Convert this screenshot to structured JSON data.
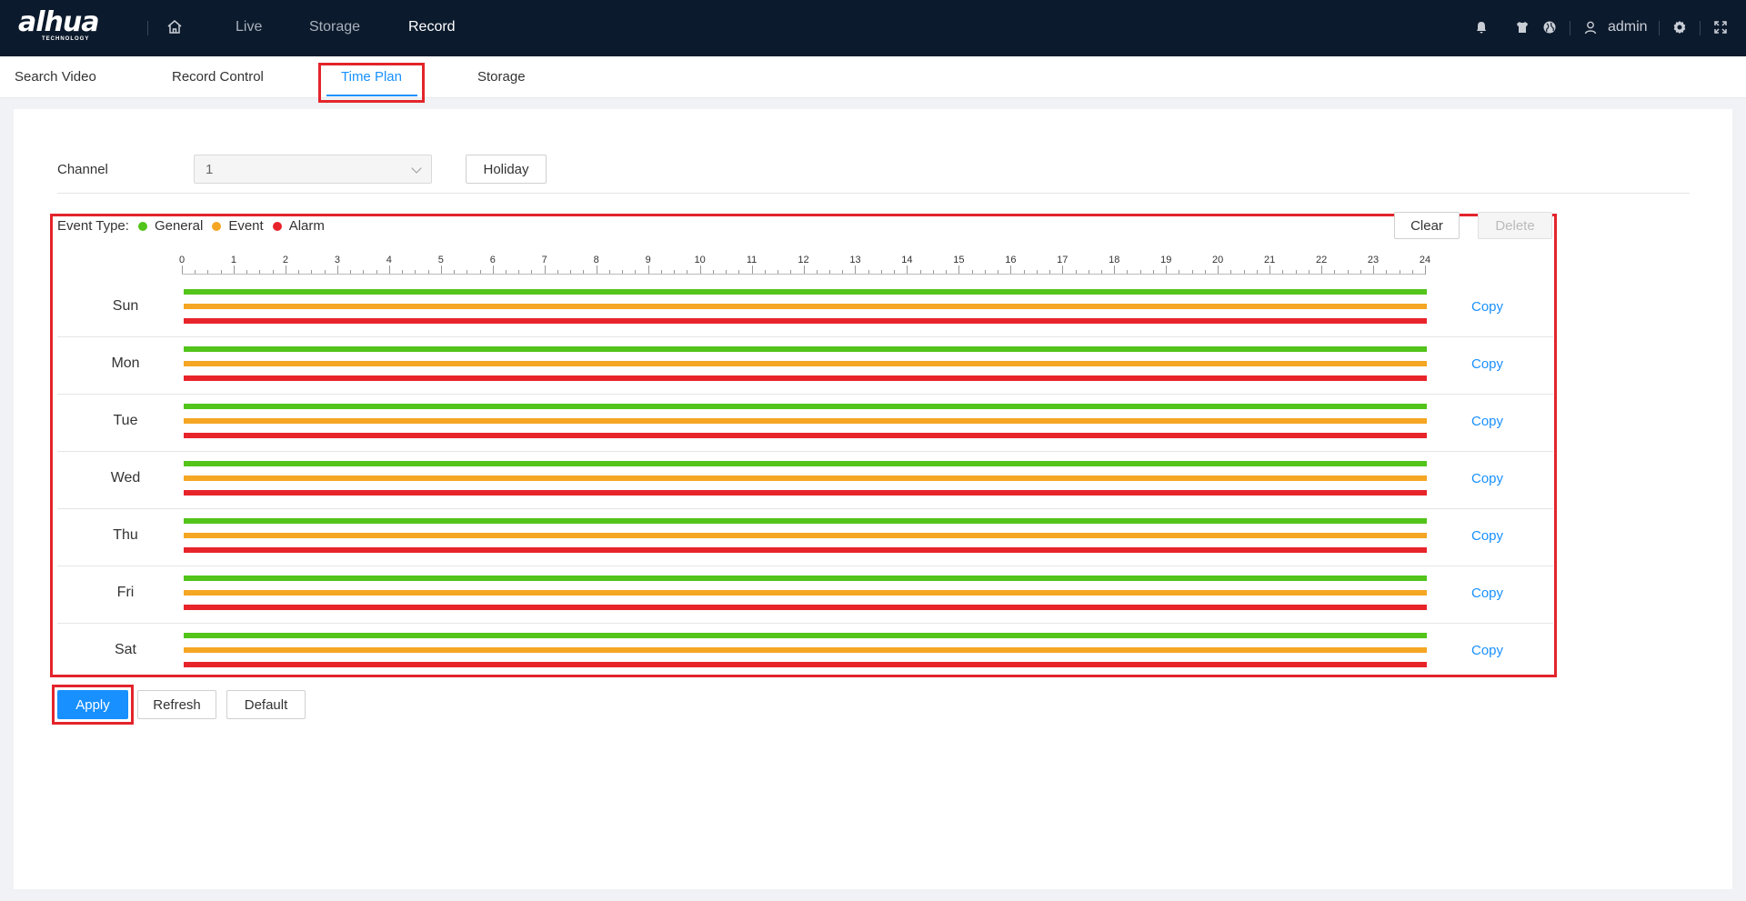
{
  "header": {
    "logo": "alhua",
    "logo_sub": "TECHNOLOGY",
    "nav": [
      "Live",
      "Storage",
      "Record"
    ],
    "active_nav": "Record",
    "user": "admin"
  },
  "subtabs": [
    "Search Video",
    "Record Control",
    "Time Plan",
    "Storage"
  ],
  "active_subtab": "Time Plan",
  "form": {
    "channel_label": "Channel",
    "channel_value": "1",
    "holiday_label": "Holiday"
  },
  "legend": {
    "label": "Event Type:",
    "items": [
      {
        "name": "General",
        "color": "#52c41a"
      },
      {
        "name": "Event",
        "color": "#f5a623"
      },
      {
        "name": "Alarm",
        "color": "#e8242b"
      }
    ]
  },
  "toolbar": {
    "clear_label": "Clear",
    "delete_label": "Delete"
  },
  "hours": [
    "0",
    "1",
    "2",
    "3",
    "4",
    "5",
    "6",
    "7",
    "8",
    "9",
    "10",
    "11",
    "12",
    "13",
    "14",
    "15",
    "16",
    "17",
    "18",
    "19",
    "20",
    "21",
    "22",
    "23",
    "24"
  ],
  "schedule": [
    {
      "day": "Sun",
      "copy": "Copy",
      "general": [
        0,
        24
      ],
      "event": [
        0,
        24
      ],
      "alarm": [
        0,
        24
      ]
    },
    {
      "day": "Mon",
      "copy": "Copy",
      "general": [
        0,
        24
      ],
      "event": [
        0,
        24
      ],
      "alarm": [
        0,
        24
      ]
    },
    {
      "day": "Tue",
      "copy": "Copy",
      "general": [
        0,
        24
      ],
      "event": [
        0,
        24
      ],
      "alarm": [
        0,
        24
      ]
    },
    {
      "day": "Wed",
      "copy": "Copy",
      "general": [
        0,
        24
      ],
      "event": [
        0,
        24
      ],
      "alarm": [
        0,
        24
      ]
    },
    {
      "day": "Thu",
      "copy": "Copy",
      "general": [
        0,
        24
      ],
      "event": [
        0,
        24
      ],
      "alarm": [
        0,
        24
      ]
    },
    {
      "day": "Fri",
      "copy": "Copy",
      "general": [
        0,
        24
      ],
      "event": [
        0,
        24
      ],
      "alarm": [
        0,
        24
      ]
    },
    {
      "day": "Sat",
      "copy": "Copy",
      "general": [
        0,
        24
      ],
      "event": [
        0,
        24
      ],
      "alarm": [
        0,
        24
      ]
    }
  ],
  "footer": {
    "apply_label": "Apply",
    "refresh_label": "Refresh",
    "default_label": "Default"
  }
}
